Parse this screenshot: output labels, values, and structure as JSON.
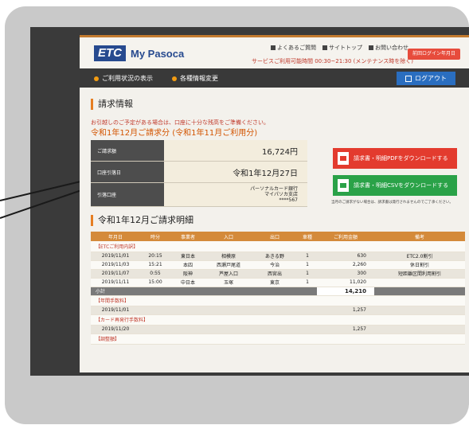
{
  "header": {
    "logo_etc": "ETC",
    "logo_name": "My Pasoca",
    "links": [
      "よくあるご質問",
      "サイトトップ",
      "お問い合わせ"
    ],
    "hours": "サービスご利用可能時間 00:30~21:30 (メンテナンス時を除く)",
    "login_history": "前回ログイン年月日"
  },
  "nav": {
    "usage": "ご利用状況の表示",
    "settings": "各種情報変更",
    "logout": "ログアウト"
  },
  "billing": {
    "title": "請求情報",
    "notice": "お引越しのご予定がある場合は、口座に十分な残高をご準備ください。",
    "period": "令和1年12月ご請求分 (令和1年11月ご利用分)",
    "rows": [
      {
        "label": "ご請求額",
        "value": "16,724円"
      },
      {
        "label": "口座引落日",
        "value": "令和1年12月27日"
      },
      {
        "label": "引落口座",
        "line1": "パーソナルカード銀行",
        "line2": "マイパソカ支店",
        "line3": "****567"
      }
    ],
    "pdf_button": "請求書・明細PDFをダウンロードする",
    "csv_button": "請求書・明細CSVをダウンロードする",
    "download_note": "当月のご請求がない場合は、請求書は発行されませんのでご了承ください。"
  },
  "detail": {
    "title": "令和1年12月ご請求明細",
    "columns": [
      "年月日",
      "時分",
      "事業者",
      "入口",
      "出口",
      "車種",
      "ご利用金額",
      "備考"
    ],
    "etc_label": "【ETCご利用内訳】",
    "etc_rows": [
      [
        "2019/11/01",
        "20:15",
        "東日本",
        "相模原",
        "あきる野",
        "1",
        "630",
        "ETC2.0割引"
      ],
      [
        "2019/11/03",
        "15:21",
        "本四",
        "西瀬戸尾道",
        "今治",
        "1",
        "2,260",
        "休日割引"
      ],
      [
        "2019/11/07",
        "0:55",
        "阪神",
        "芦屋入口",
        "西宮出",
        "1",
        "300",
        "短距離区間利用割引"
      ],
      [
        "2019/11/11",
        "15:00",
        "中日本",
        "玉塚",
        "東京",
        "1",
        "11,020",
        ""
      ]
    ],
    "subtotal_label": "小計",
    "subtotal_value": "14,210",
    "annual_fee_label": "【年間手数料】",
    "annual_fee_row": [
      "2019/11/01",
      "1,257"
    ],
    "reissue_label": "【カード再発行手数料】",
    "reissue_row": [
      "2019/11/20",
      "1,257"
    ],
    "adjust_label": "【調整額】"
  }
}
